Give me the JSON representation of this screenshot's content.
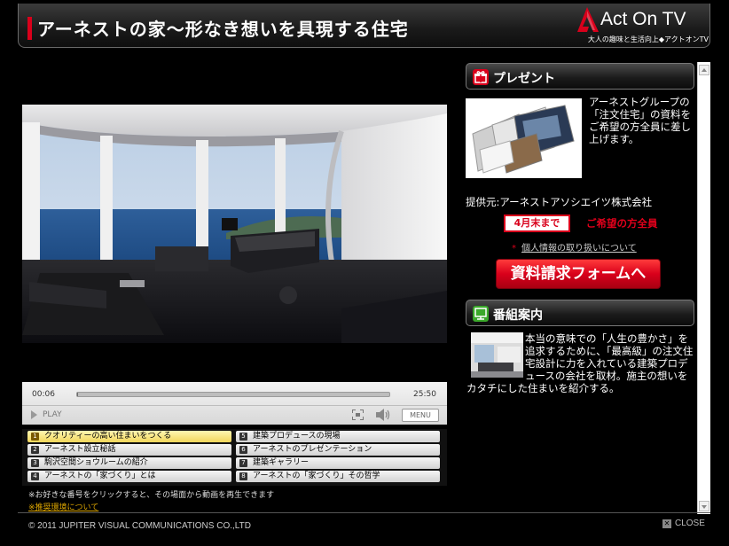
{
  "header": {
    "title": "アーネストの家〜形なき想いを具現する住宅",
    "logo_text": "Act On TV",
    "logo_tagline": "大人の趣味と生活向上◆アクトオンTV"
  },
  "player": {
    "current_time": "00:06",
    "duration": "25:50",
    "progress_fraction": 0.004,
    "play_label": "PLAY",
    "menu_label": "MENU"
  },
  "chapters": [
    {
      "num": "1",
      "label": "クオリティーの高い住まいをつくる",
      "active": true
    },
    {
      "num": "2",
      "label": "アーネスト設立秘話",
      "active": false
    },
    {
      "num": "3",
      "label": "駒沢空間ショウルームの紹介",
      "active": false
    },
    {
      "num": "4",
      "label": "アーネストの「家づくり」とは",
      "active": false
    },
    {
      "num": "5",
      "label": "建築プロデュースの現場",
      "active": false
    },
    {
      "num": "6",
      "label": "アーネストのプレゼンテーション",
      "active": false
    },
    {
      "num": "7",
      "label": "建築ギャラリー",
      "active": false
    },
    {
      "num": "8",
      "label": "アーネストの「家づくり」その哲学",
      "active": false
    }
  ],
  "chapter_note": "※お好きな番号をクリックすると、その場面から動画を再生できます",
  "env_link": "※推奨環境について",
  "present": {
    "heading": "プレゼント",
    "description": "アーネストグループの「注文住宅」の資料をご希望の方全員に差し上げます。",
    "provider": "提供元:アーネストアソシエイツ株式会社",
    "deadline": "4月末まで",
    "wish": "ご希望の方全員",
    "privacy_mark": "*",
    "privacy_link": "個人情報の取り扱いについて",
    "form_button": "資料請求フォームへ"
  },
  "program": {
    "heading": "番組案内",
    "description": "本当の意味での「人生の豊かさ」を追求するために、「最高級」の注文住宅設計に力を入れている建築プロデュースの会社を取材。施主の想いをカタチにした住まいを紹介する。"
  },
  "footer": {
    "copyright": "© 2011 JUPITER VISUAL COMMUNICATIONS CO.,LTD",
    "close_label": "CLOSE"
  },
  "colors": {
    "accent_red": "#d9001b",
    "background": "#000000",
    "active_chapter": "#f2d65a"
  },
  "icons": [
    "act-on-tv-logo-icon",
    "gift-icon",
    "tv-icon",
    "play-icon",
    "fullscreen-icon",
    "volume-icon",
    "close-icon"
  ]
}
